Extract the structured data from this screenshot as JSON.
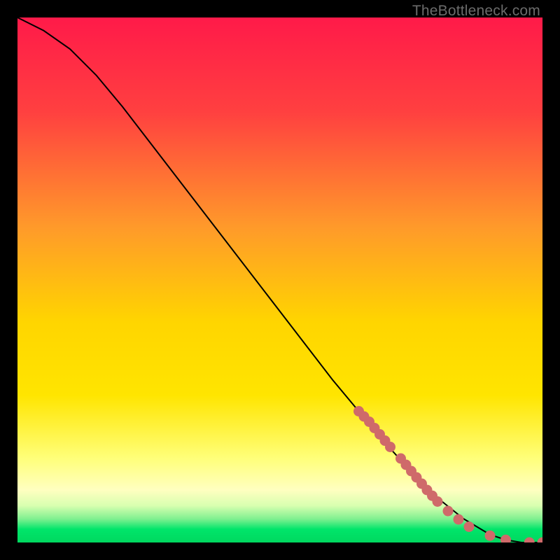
{
  "watermark": "TheBottleneck.com",
  "colors": {
    "red": "#ff1a49",
    "orange": "#ff8a2a",
    "yellow": "#ffe500",
    "pale_yellow": "#ffff9a",
    "pale_green": "#b8ffb8",
    "green": "#00e56a",
    "point": "#cf6a6a",
    "line": "#000000",
    "frame": "#000000"
  },
  "chart_data": {
    "type": "line",
    "title": "",
    "xlabel": "",
    "ylabel": "",
    "xlim": [
      0,
      100
    ],
    "ylim": [
      0,
      100
    ],
    "series": [
      {
        "name": "curve",
        "x": [
          0,
          5,
          10,
          15,
          20,
          25,
          30,
          35,
          40,
          45,
          50,
          55,
          60,
          65,
          70,
          75,
          80,
          85,
          90,
          93,
          96,
          98,
          100
        ],
        "y": [
          100,
          97.5,
          94,
          89,
          83,
          76.5,
          70,
          63.5,
          57,
          50.5,
          44,
          37.5,
          31,
          25,
          19,
          13.5,
          8.5,
          4.5,
          1.5,
          0.5,
          0,
          0,
          0
        ]
      }
    ],
    "points": {
      "name": "highlighted-segment",
      "x": [
        65,
        66,
        67,
        68,
        69,
        70,
        71,
        73,
        74,
        75,
        76,
        77,
        78,
        79,
        80,
        82,
        84,
        86,
        90,
        93,
        97.5,
        100
      ],
      "y": [
        25,
        24,
        23,
        21.8,
        20.6,
        19.4,
        18.2,
        16,
        14.8,
        13.6,
        12.4,
        11.2,
        10.0,
        8.9,
        7.8,
        6.0,
        4.4,
        3.0,
        1.3,
        0.5,
        0,
        0
      ]
    },
    "gradient_stops": [
      {
        "offset": 0.0,
        "color": "#ff1a49"
      },
      {
        "offset": 0.18,
        "color": "#ff4040"
      },
      {
        "offset": 0.4,
        "color": "#ff9a2a"
      },
      {
        "offset": 0.58,
        "color": "#ffd500"
      },
      {
        "offset": 0.72,
        "color": "#ffe500"
      },
      {
        "offset": 0.84,
        "color": "#ffff7a"
      },
      {
        "offset": 0.9,
        "color": "#ffffc0"
      },
      {
        "offset": 0.93,
        "color": "#d8ffb0"
      },
      {
        "offset": 0.955,
        "color": "#80f090"
      },
      {
        "offset": 0.975,
        "color": "#00e56a"
      },
      {
        "offset": 1.0,
        "color": "#00d85f"
      }
    ]
  }
}
